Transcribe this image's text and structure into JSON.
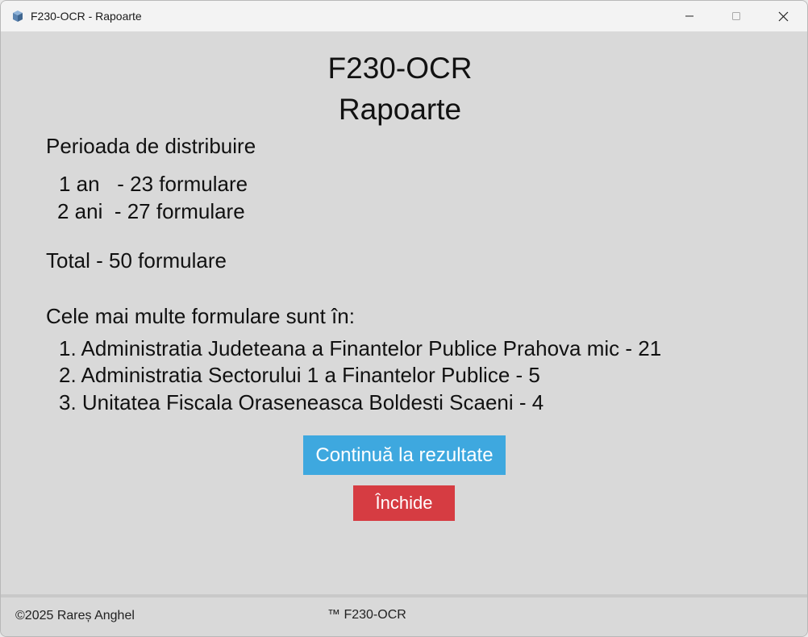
{
  "window": {
    "title": "F230-OCR - Rapoarte",
    "app_icon": "cube-icon",
    "controls": {
      "minimize": "minimize-icon",
      "maximize": "maximize-icon",
      "close": "close-icon"
    }
  },
  "header": {
    "title": "F230-OCR",
    "subtitle": "Rapoarte"
  },
  "distribution": {
    "label": "Perioada de distribuire",
    "rows": [
      "1 an   - 23 formulare",
      "2 ani  - 27 formulare"
    ]
  },
  "total": "Total - 50 formulare",
  "top": {
    "label": "Cele mai multe formulare sunt în:",
    "items": [
      "1. Administratia Judeteana a Finantelor Publice Prahova mic - 21",
      "2. Administratia Sectorului 1 a Finantelor Publice - 5",
      "3. Unitatea Fiscala Oraseneasca Boldesti Scaeni - 4"
    ]
  },
  "buttons": {
    "continue": "Continuă la rezultate",
    "close": "Închide",
    "continue_color": "#3ea8df",
    "close_color": "#d63c42"
  },
  "footer": {
    "copyright": "©2025 Rareș Anghel",
    "brand": "™ F230-OCR"
  }
}
